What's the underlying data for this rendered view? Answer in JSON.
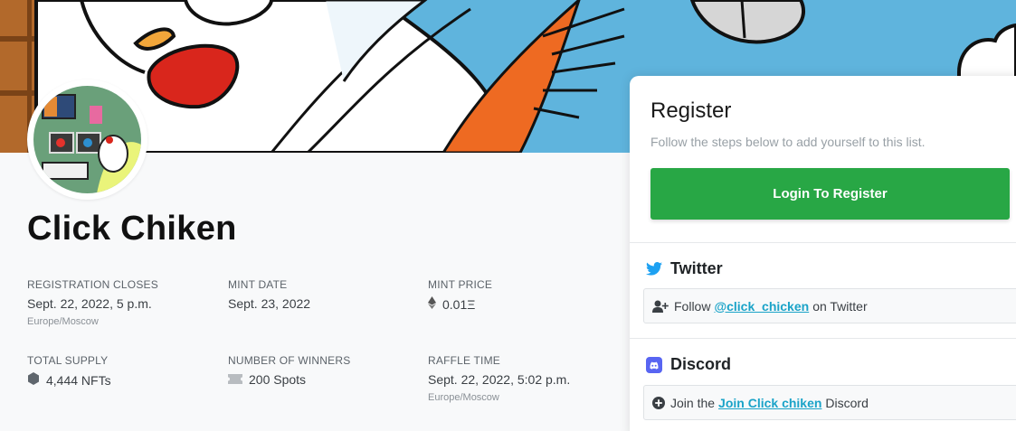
{
  "project": {
    "title": "Click Chiken"
  },
  "stats": {
    "registration_closes": {
      "label": "REGISTRATION CLOSES",
      "value": "Sept. 22, 2022, 5 p.m.",
      "sub": "Europe/Moscow"
    },
    "mint_date": {
      "label": "MINT DATE",
      "value": "Sept. 23, 2022"
    },
    "mint_price": {
      "label": "MINT PRICE",
      "value": "0.01Ξ",
      "icon": "ethereum-icon"
    },
    "total_supply": {
      "label": "TOTAL SUPPLY",
      "value": "4,444 NFTs",
      "icon": "coin-icon"
    },
    "number_of_winners": {
      "label": "NUMBER OF WINNERS",
      "value": "200 Spots",
      "icon": "ticket-icon"
    },
    "raffle_time": {
      "label": "RAFFLE TIME",
      "value": "Sept. 22, 2022, 5:02 p.m.",
      "sub": "Europe/Moscow"
    }
  },
  "register": {
    "title": "Register",
    "subtitle": "Follow the steps below to add yourself to this list.",
    "login_button": "Login To Register"
  },
  "tasks": {
    "twitter": {
      "heading": "Twitter",
      "icon": "twitter-icon",
      "prefix": "Follow",
      "link": "@click_chicken",
      "suffix": "on Twitter",
      "task_icon": "user-plus-icon"
    },
    "discord": {
      "heading": "Discord",
      "icon": "discord-icon",
      "prefix": "Join the",
      "link": "Join Click chiken",
      "suffix": "Discord",
      "task_icon": "plus-circle-icon"
    }
  },
  "colors": {
    "banner_sky": "#5fb4dd",
    "primary_button": "#28a745",
    "link": "#1aa3c8",
    "twitter": "#1da1f2",
    "discord": "#5865f2"
  }
}
